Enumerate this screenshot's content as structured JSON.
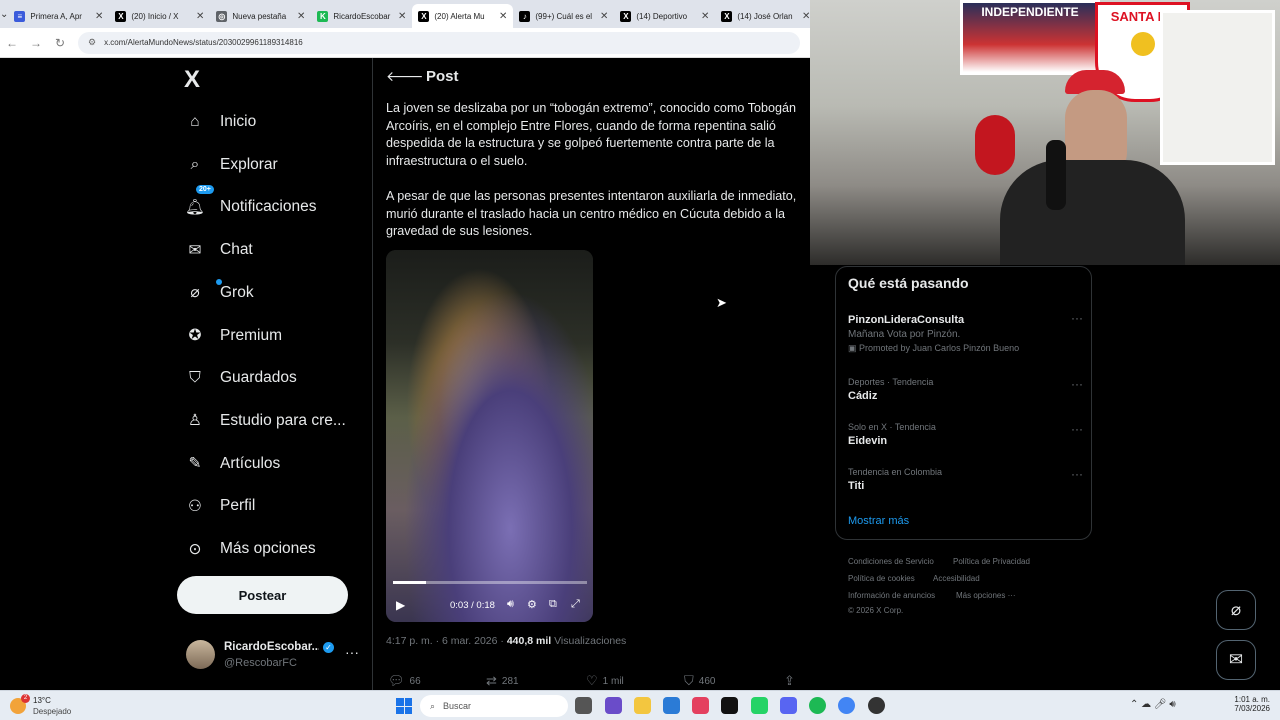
{
  "browser": {
    "tabs": [
      {
        "label": "Primera A, Apr",
        "color": "#3b5bdb",
        "glyph": "≡"
      },
      {
        "label": "(20) Inicio / X",
        "color": "#000",
        "glyph": "X"
      },
      {
        "label": "Nueva pestaña",
        "color": "#5f6368",
        "glyph": "◎"
      },
      {
        "label": "RicardoEscobar",
        "color": "#1db954",
        "glyph": "K"
      },
      {
        "label": "(20) Alerta Mu",
        "color": "#000",
        "glyph": "X"
      },
      {
        "label": "(99+) Cuál es el",
        "color": "#000",
        "glyph": "♪"
      },
      {
        "label": "(14) Deportivo",
        "color": "#000",
        "glyph": "X"
      },
      {
        "label": "(14) José Orlan",
        "color": "#000",
        "glyph": "X"
      }
    ],
    "url": "x.com/AlertaMundoNews/status/2030029961189314816"
  },
  "nav": {
    "logo": "X",
    "items": [
      {
        "label": "Inicio",
        "icon": "home-icon"
      },
      {
        "label": "Explorar",
        "icon": "search-icon"
      },
      {
        "label": "Notificaciones",
        "icon": "bell-icon",
        "badge": "20+"
      },
      {
        "label": "Chat",
        "icon": "mail-icon"
      },
      {
        "label": "Grok",
        "icon": "grok-icon"
      },
      {
        "label": "Premium",
        "icon": "premium-icon"
      },
      {
        "label": "Guardados",
        "icon": "bookmark-icon"
      },
      {
        "label": "Estudio para cre...",
        "icon": "studio-icon"
      },
      {
        "label": "Artículos",
        "icon": "articles-icon"
      },
      {
        "label": "Perfil",
        "icon": "person-icon"
      },
      {
        "label": "Más opciones",
        "icon": "more-icon"
      }
    ],
    "post_button": "Postear",
    "account": {
      "name": "RicardoEscobar...",
      "handle": "@RescobarFC"
    }
  },
  "post": {
    "header": "Post",
    "paragraph1": "La joven se deslizaba por un “tobogán extremo”, conocido como Tobogán Arcoíris, en el complejo Entre Flores, cuando de forma repentina salió despedida de la estructura y se golpeó fuertemente contra parte de la infraestructura o el suelo.",
    "paragraph2": "A pesar de que las personas presentes intentaron auxiliarla de inmediato, murió durante el traslado hacia un centro médico en Cúcuta debido a la gravedad de sus lesiones.",
    "video": {
      "time": "0:03 / 0:18",
      "progress": 0.17
    },
    "timestamp": "4:17 p. m. · 6 mar. 2026 · ",
    "views_count": "440,8 mil",
    "views_label": "Visualizaciones",
    "replies": "66",
    "reposts": "281",
    "likes": "1 mil",
    "bookmarks": "460"
  },
  "trending": {
    "title": "Qué está pasando",
    "items": [
      {
        "context": "",
        "title": "PinzonLideraConsulta",
        "sub": "Mañana Vota por Pinzón.",
        "promoted": "Promoted by Juan Carlos Pinzón Bueno"
      },
      {
        "context": "Deportes · Tendencia",
        "title": "Cádiz"
      },
      {
        "context": "Solo en X · Tendencia",
        "title": "Eidevin"
      },
      {
        "context": "Tendencia en Colombia",
        "title": "Titi"
      }
    ],
    "show_more": "Mostrar más"
  },
  "footer": {
    "links": [
      "Condiciones de Servicio",
      "Política de Privacidad",
      "Política de cookies",
      "Accesibilidad",
      "Información de anuncios",
      "Más opciones ···",
      "© 2026 X Corp."
    ]
  },
  "webcam": {
    "sign_left": "INDEPENDIENTE",
    "sign_right": "SANTA FE"
  },
  "taskbar": {
    "weather_temp": "13°C",
    "weather_desc": "Despejado",
    "weather_badge": "2",
    "search": "Buscar",
    "time": "1:01 a. m.",
    "date": "7/03/2026"
  }
}
